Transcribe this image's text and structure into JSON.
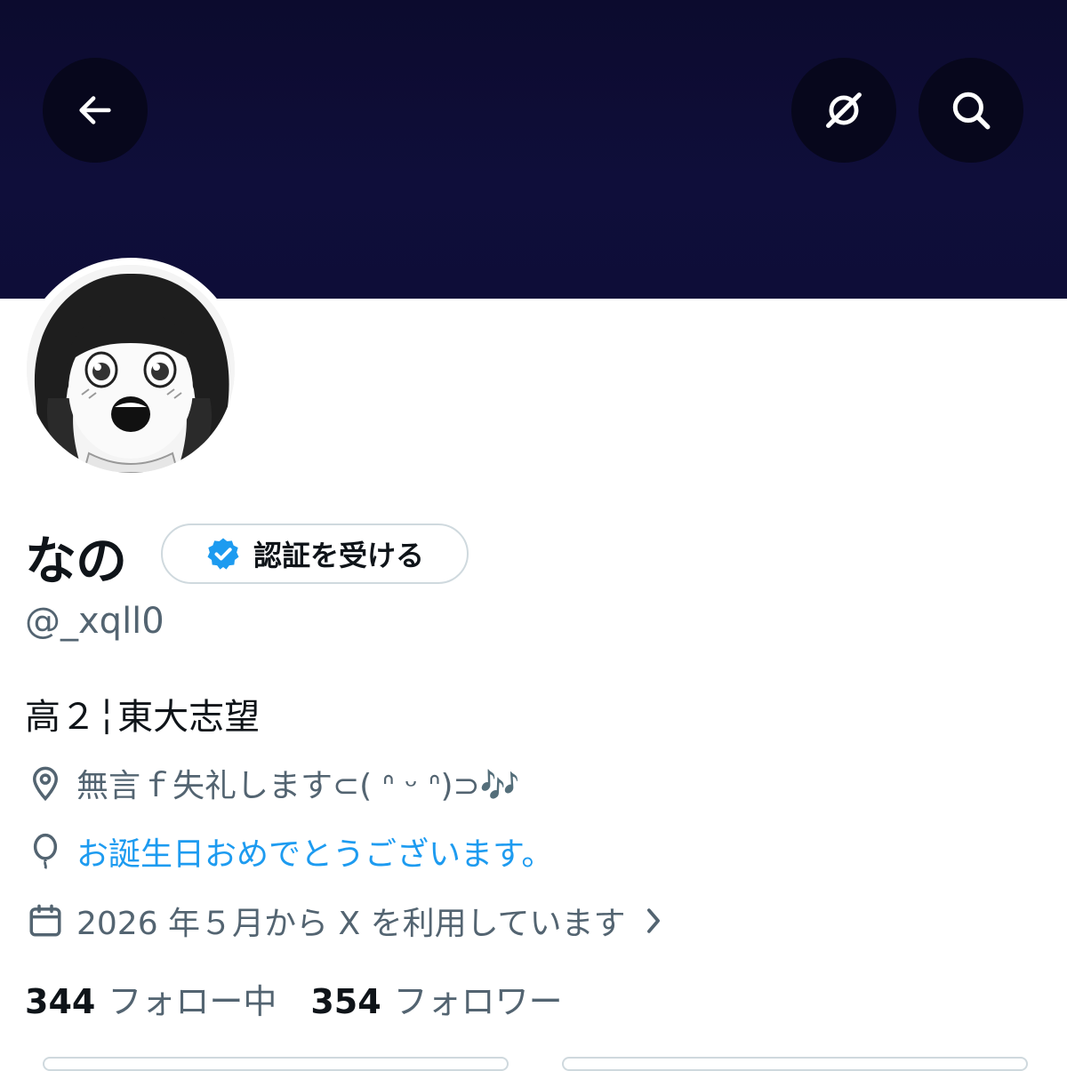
{
  "profile": {
    "name": "なの",
    "handle": "@_xqll0",
    "bio": "高２╎東大志望",
    "location": "無言ｆ失礼します⊂(  ᐢ ᵕ ᐢ)⊃🎶",
    "birthday": "お誕生日おめでとうございます。",
    "joined": "2026 年５月から X を利用しています"
  },
  "verify_button": {
    "label": "認証を受ける"
  },
  "stats": {
    "following_count": "344",
    "following_label": "フォロー中",
    "followers_count": "354",
    "followers_label": "フォロワー"
  },
  "icons": {
    "back": "back-arrow-icon",
    "grok": "grok-icon",
    "search": "search-icon",
    "verified": "verified-badge-icon",
    "location": "location-pin-icon",
    "birthday": "balloon-icon",
    "calendar": "calendar-icon",
    "chevron": "chevron-right-icon"
  },
  "colors": {
    "banner": "#0e0d38",
    "accent": "#1d9bf0",
    "secondary_text": "#536471"
  }
}
